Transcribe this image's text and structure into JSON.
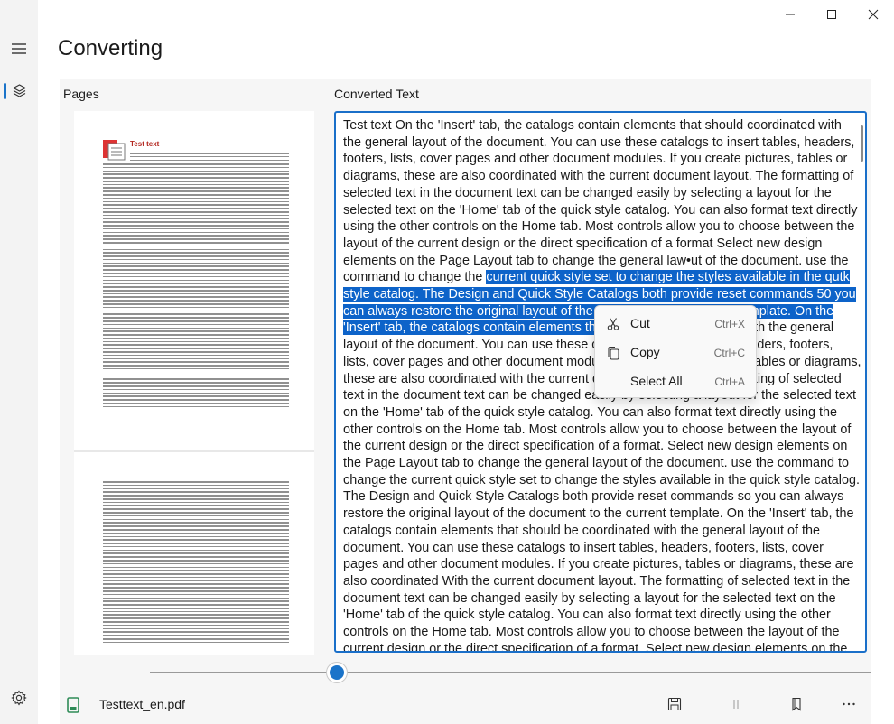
{
  "window": {
    "title": "Converting",
    "controls": [
      "minimize-icon",
      "maximize-icon",
      "close-icon"
    ]
  },
  "nav": {
    "menu_icon": "hamburger-icon",
    "items": [
      {
        "icon": "layers-icon",
        "selected": true
      }
    ],
    "footer_icon": "gear-icon"
  },
  "pages_panel": {
    "label": "Pages",
    "thumbnail_title": "Test text"
  },
  "converted_panel": {
    "label": "Converted Text",
    "text_before_selection": "Test text On the 'Insert' tab, the catalogs contain elements that should coordinated with the general layout of the document. You can use these catalogs to insert tables, headers, footers, lists, cover pages and other document modules. If you create pictures, tables or diagrams, these are also coordinated with the current document layout. The formatting of selected text in the document text can be changed easily by selecting a layout for the selected text on the 'Home' tab of the quick style catalog. You can also format text directly using the other controls on the Home tab. Most controls allow you to choose between the layout of the current design or the direct specification of a format Select new design elements on the Page Layout tab to change the general law•ut of the document. use the command to change the ",
    "selected_text": "current quick style set to change the styles available in the qutk style catalog. The Design and Quick Style Catalogs both provide reset commands 50 you can always restore the original layout of the document to the current template. On the 'Insert' tab, the catalogs contain elements that should be coordinated",
    "text_after_selection": " with the general layout of the document. You can use these catalogs to insert tables, headers, footers, lists, cover pages and other document modules. If you create pictures, tables or diagrams, these are also coordinated with the current document layout The formatting of selected text in the document text can be changed easily by selecting a layout for the selected text on the 'Home' tab of the quick style catalog. You can also format text directly using the other controls on the Home tab. Most controls allow you to choose between the layout of the current design or the direct specification of a format. Select new design elements on the Page Layout tab to change the general layout of the document. use the command to change the current quick style set to change the styles available in the quick style catalog. The Design and Quick Style Catalogs both provide reset commands so you can always restore the original layout of the document to the current template. On the 'Insert' tab, the catalogs contain elements that should be coordinated with the general layout of the document. You can use these catalogs to insert tables, headers, footers, lists, cover pages and other document modules. If you create pictures, tables or diagrams, these are also coordinated With the current document layout. The formatting of selected text in the document text can be changed easily by selecting a layout for the selected text on the 'Home' tab of the quick style catalog. You can also format text directly using the other controls on the Home tab. Most controls allow you to choose between the layout of the current design or the direct specification of a format. Select new design elements on the Page Layout tab to change the general layout of the document. use"
  },
  "context_menu": {
    "items": [
      {
        "label": "Cut",
        "shortcut": "Ctrl+X",
        "icon": "scissors-icon"
      },
      {
        "label": "Copy",
        "shortcut": "Ctrl+C",
        "icon": "copy-icon"
      },
      {
        "label": "Select All",
        "shortcut": "Ctrl+A",
        "icon": ""
      }
    ]
  },
  "slider": {
    "position_fraction": 0.26
  },
  "bottom_bar": {
    "file_name": "Testtext_en.pdf",
    "file_icon": "document-icon",
    "buttons": [
      "save-icon",
      "pause-icon",
      "bookmark-icon",
      "more-icon"
    ]
  },
  "colors": {
    "accent": "#1a73c9",
    "selection": "#0d63c9",
    "file_icon": "#2e8b57"
  }
}
